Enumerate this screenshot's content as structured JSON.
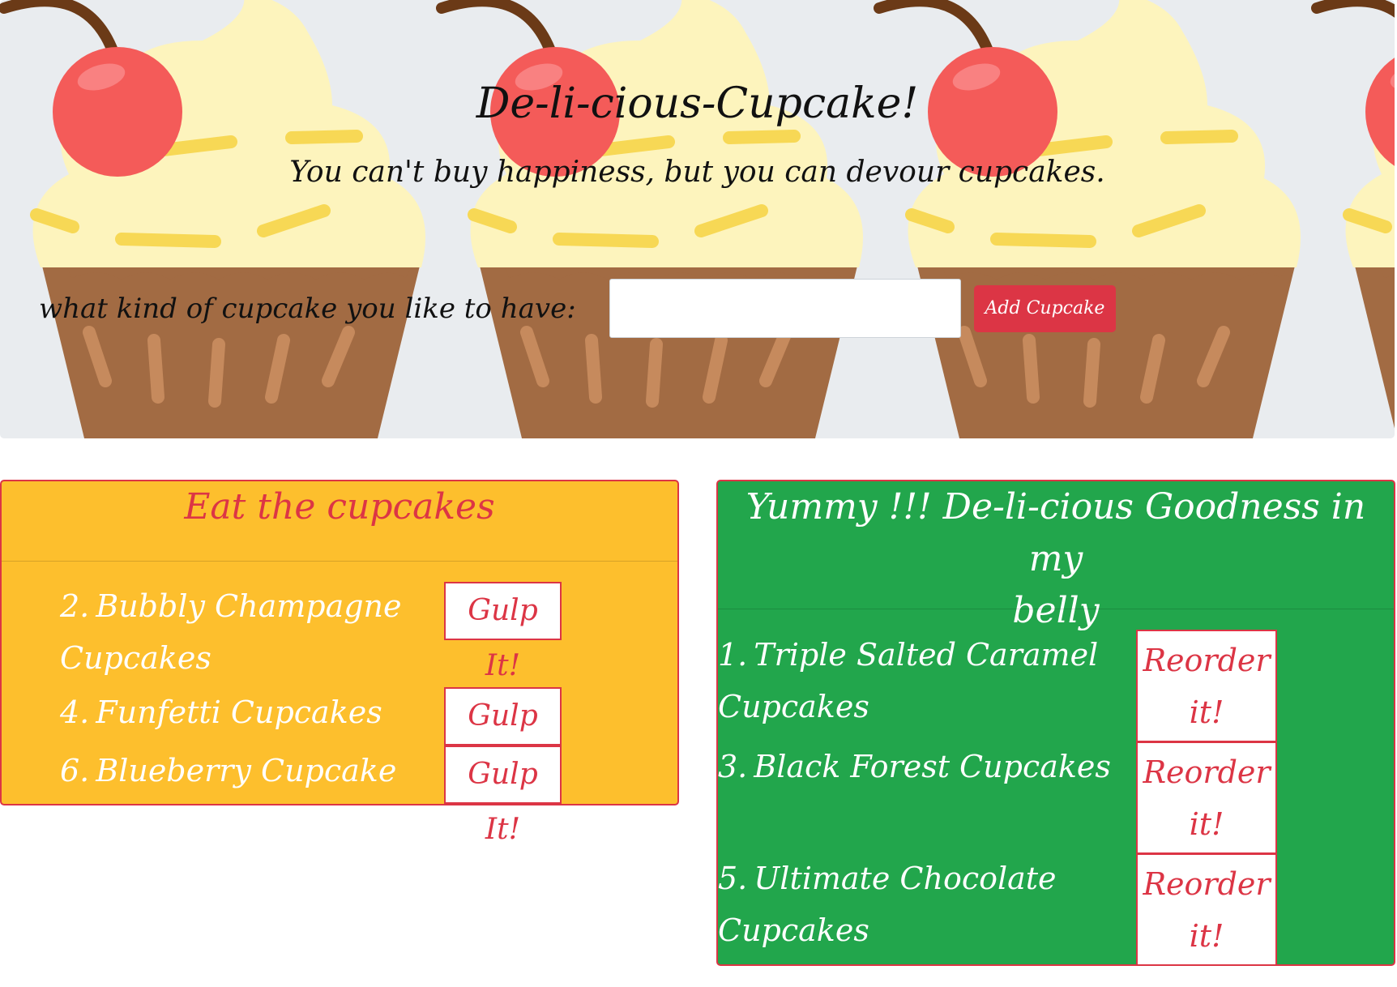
{
  "header": {
    "title": "De-li-cious-Cupcake!",
    "tagline": "You can't buy happiness, but you can devour cupcakes."
  },
  "form": {
    "label": "what kind of cupcake you like to have:",
    "input_value": "",
    "add_button_label": "Add Cupcake"
  },
  "eat_panel": {
    "title": "Eat the cupcakes",
    "button_label": "Gulp It!",
    "items": [
      {
        "number": "2.",
        "name_line1": "Bubbly Champagne",
        "name_line2": "Cupcakes"
      },
      {
        "number": "4.",
        "name_line1": "Funfetti Cupcakes",
        "name_line2": ""
      },
      {
        "number": "6.",
        "name_line1": "Blueberry Cupcake",
        "name_line2": ""
      }
    ]
  },
  "yummy_panel": {
    "title_line1": "Yummy !!! De-li-cious Goodness in my",
    "title_line2": "belly",
    "button_line1": "Reorder",
    "button_line2": "it!",
    "items": [
      {
        "number": "1.",
        "name_line1": "Triple Salted Caramel",
        "name_line2": "Cupcakes"
      },
      {
        "number": "3.",
        "name_line1": "Black Forest Cupcakes",
        "name_line2": ""
      },
      {
        "number": "5.",
        "name_line1": "Ultimate Chocolate",
        "name_line2": "Cupcakes"
      }
    ]
  },
  "colors": {
    "hero_bg": "#e9ecef",
    "danger": "#dc3545",
    "eat_panel_bg": "#fdbf2d",
    "yummy_panel_bg": "#22a64c",
    "cherry": "#f45b59",
    "frosting": "#fdf4bd",
    "sprinkle": "#f7d855",
    "wrapper": "#a26b43",
    "stem": "#6b3a17"
  },
  "icons": {
    "hero_background": "cupcake-pattern-icon"
  }
}
